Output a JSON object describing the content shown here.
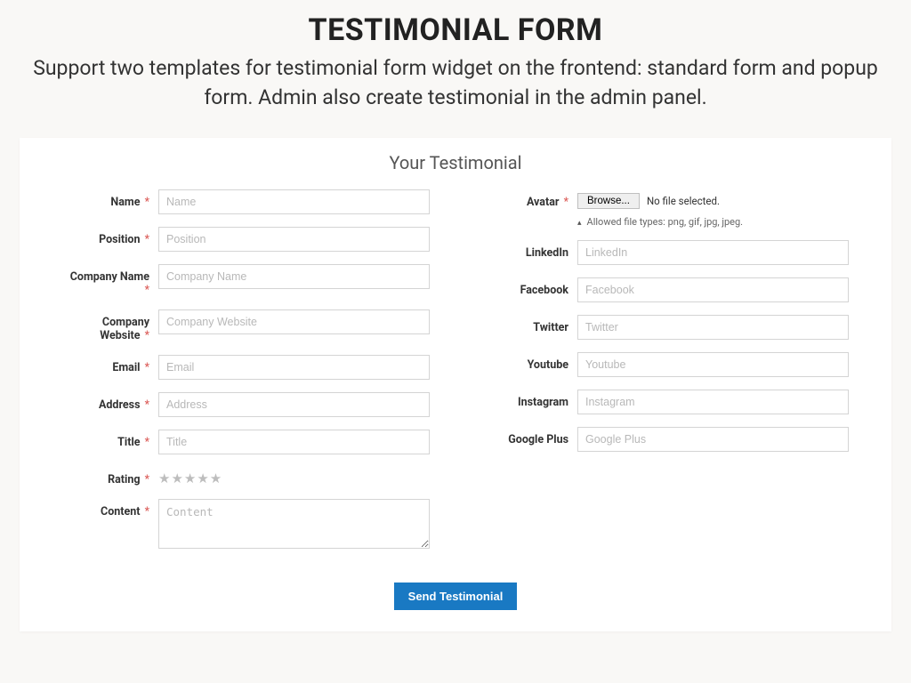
{
  "header": {
    "title": "TESTIMONIAL FORM",
    "subtitle": "Support two templates for testimonial form widget on the frontend: standard form and popup form. Admin also create testimonial in the admin panel."
  },
  "form": {
    "title": "Your Testimonial",
    "submit_label": "Send Testimonial",
    "left": {
      "name": {
        "label": "Name",
        "placeholder": "Name"
      },
      "position": {
        "label": "Position",
        "placeholder": "Position"
      },
      "company_name": {
        "label": "Company Name",
        "placeholder": "Company Name"
      },
      "company_website": {
        "label": "Company Website",
        "placeholder": "Company Website"
      },
      "email": {
        "label": "Email",
        "placeholder": "Email"
      },
      "address": {
        "label": "Address",
        "placeholder": "Address"
      },
      "title": {
        "label": "Title",
        "placeholder": "Title"
      },
      "rating": {
        "label": "Rating"
      },
      "content": {
        "label": "Content",
        "placeholder": "Content"
      }
    },
    "right": {
      "avatar": {
        "label": "Avatar",
        "browse_label": "Browse...",
        "status": "No file selected.",
        "hint": "Allowed file types: png, gif, jpg, jpeg."
      },
      "linkedin": {
        "label": "LinkedIn",
        "placeholder": "LinkedIn"
      },
      "facebook": {
        "label": "Facebook",
        "placeholder": "Facebook"
      },
      "twitter": {
        "label": "Twitter",
        "placeholder": "Twitter"
      },
      "youtube": {
        "label": "Youtube",
        "placeholder": "Youtube"
      },
      "instagram": {
        "label": "Instagram",
        "placeholder": "Instagram"
      },
      "google_plus": {
        "label": "Google Plus",
        "placeholder": "Google Plus"
      }
    }
  }
}
